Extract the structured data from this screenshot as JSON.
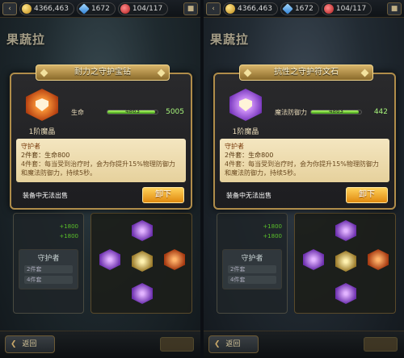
{
  "panels": [
    {
      "topbar": {
        "back": "‹",
        "gold": "4366,463",
        "diamonds": "1672",
        "stamina": "104/117",
        "shirt": ""
      },
      "hero": {
        "sub": "",
        "name": "果蔬拉"
      },
      "popup": {
        "title": "耐力之守护宝钻",
        "tier": "1阶魔晶",
        "stat_label": "生命",
        "stat_bar_text": "4863",
        "stat_value": "5005",
        "bar_fraction": 0.95,
        "desc_title": "守护者",
        "desc_line2": "2件套：生命800",
        "desc_line3": "4件套：每当受到治疗时，会为你提升15%物理防御力和魔法防御力，持续5秒。",
        "footer_note": "装备中无法出售",
        "unequip": "卸下",
        "icon_name": "orange-gem-icon"
      },
      "lower": {
        "left_label1": "",
        "left_label2": "",
        "left_gain1": "+1800",
        "left_gain2": "+1800",
        "guard_title": "守护者",
        "guard_item1": "2件套",
        "guard_item2": "4件套"
      },
      "bottom": {
        "return": "返回"
      }
    },
    {
      "topbar": {
        "back": "‹",
        "gold": "4366,463",
        "diamonds": "1672",
        "stamina": "104/117",
        "shirt": ""
      },
      "hero": {
        "sub": "",
        "name": "果蔬拉"
      },
      "popup": {
        "title": "抗性之守护符文石",
        "tier": "1阶魔晶",
        "stat_label": "魔法防御力",
        "stat_bar_text": "4863",
        "stat_value": "442",
        "bar_fraction": 0.95,
        "desc_title": "守护者",
        "desc_line2": "2件套：生命800",
        "desc_line3": "4件套：每当受到治疗时，会为你提升15%物理防御力和魔法防御力，持续5秒。",
        "footer_note": "装备中无法出售",
        "unequip": "卸下",
        "icon_name": "purple-gem-icon"
      },
      "lower": {
        "left_label1": "",
        "left_label2": "",
        "left_gain1": "+1800",
        "left_gain2": "+1800",
        "guard_title": "守护者",
        "guard_item1": "2件套",
        "guard_item2": "4件套"
      },
      "bottom": {
        "return": "返回"
      }
    }
  ]
}
